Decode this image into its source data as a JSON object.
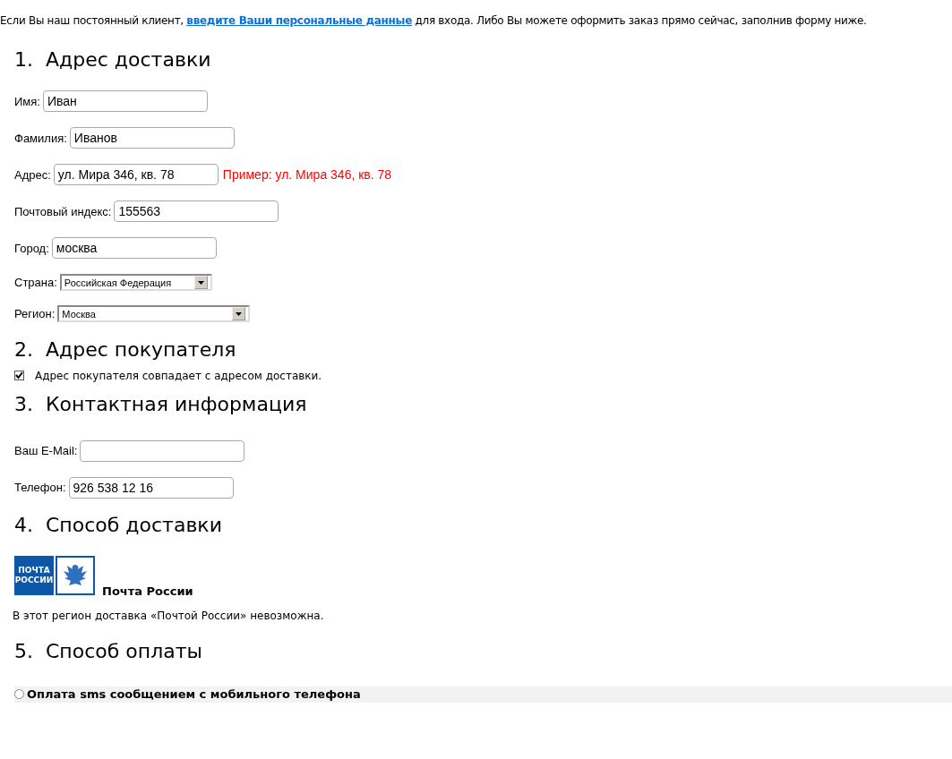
{
  "intro": {
    "before": "Если Вы наш постоянный клиент, ",
    "link": "введите Ваши персональные данные",
    "after": " для входа. Либо Вы можете оформить заказ прямо сейчас, заполнив форму ниже."
  },
  "sections": [
    {
      "number": "1.",
      "title": "Адрес доставки",
      "fields": [
        {
          "kind": "text",
          "label": "Имя:",
          "value": "Иван"
        },
        {
          "kind": "text",
          "label": "Фамилия:",
          "value": "Иванов"
        },
        {
          "kind": "text",
          "label": "Адрес:",
          "value": "ул. Мира 346, кв. 78",
          "hint": "Пример: ул. Мира 346, кв. 78"
        },
        {
          "kind": "text",
          "label": "Почтовый индекс:",
          "value": "155563"
        },
        {
          "kind": "text",
          "label": "Город:",
          "value": "москва"
        },
        {
          "kind": "select",
          "label": "Страна:",
          "value": "Российская Федерация"
        },
        {
          "kind": "select",
          "label": "Регион:",
          "value": "Москва"
        }
      ]
    },
    {
      "number": "2.",
      "title": "Адрес покупателя",
      "checkbox": {
        "label": "Адрес покупателя совпадает с адресом доставки.",
        "checked": true
      }
    },
    {
      "number": "3.",
      "title": "Контактная информация",
      "fields": [
        {
          "kind": "text",
          "label": "Ваш E-Mail:"
        },
        {
          "kind": "text",
          "label": "Телефон:",
          "value": "926 538 12 16"
        }
      ]
    },
    {
      "number": "4.",
      "title": "Способ доставки",
      "carrier": {
        "logo_lines": [
          "ПОЧТА",
          "РОССИИ"
        ],
        "name": "Почта России"
      },
      "note": "В этот регион доставка «Почтой России» невозможна."
    },
    {
      "number": "5.",
      "title": "Способ оплаты",
      "options": [
        {
          "label": "Оплата sms сообщением с мобильного телефона",
          "selected": false
        }
      ]
    }
  ]
}
